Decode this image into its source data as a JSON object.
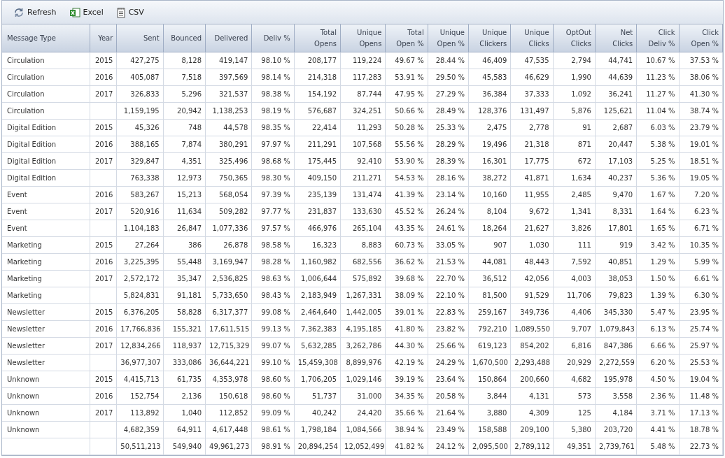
{
  "toolbar": [
    {
      "kind": "refresh",
      "label": "Refresh"
    },
    {
      "kind": "excel",
      "label": "Excel"
    },
    {
      "kind": "csv",
      "label": "CSV"
    }
  ],
  "table": {
    "columns": [
      "Message Type",
      "Year",
      "Sent",
      "Bounced",
      "Delivered",
      "Deliv %",
      "Total Opens",
      "Unique Opens",
      "Total Open %",
      "Unique Open %",
      "Unique Clickers",
      "Unique Clicks",
      "OptOut Clicks",
      "Net Clicks",
      "Click Deliv %",
      "Click Open %"
    ],
    "rows": [
      [
        "Circulation",
        "2015",
        "427,275",
        "8,128",
        "419,147",
        "98.10 %",
        "208,177",
        "119,224",
        "49.67 %",
        "28.44 %",
        "46,409",
        "47,535",
        "2,794",
        "44,741",
        "10.67 %",
        "37.53 %"
      ],
      [
        "Circulation",
        "2016",
        "405,087",
        "7,518",
        "397,569",
        "98.14 %",
        "214,318",
        "117,283",
        "53.91 %",
        "29.50 %",
        "45,583",
        "46,629",
        "1,990",
        "44,639",
        "11.23 %",
        "38.06 %"
      ],
      [
        "Circulation",
        "2017",
        "326,833",
        "5,296",
        "321,537",
        "98.38 %",
        "154,192",
        "87,744",
        "47.95 %",
        "27.29 %",
        "36,384",
        "37,333",
        "1,092",
        "36,241",
        "11.27 %",
        "41.30 %"
      ],
      [
        "Circulation",
        "",
        "1,159,195",
        "20,942",
        "1,138,253",
        "98.19 %",
        "576,687",
        "324,251",
        "50.66 %",
        "28.49 %",
        "128,376",
        "131,497",
        "5,876",
        "125,621",
        "11.04 %",
        "38.74 %"
      ],
      [
        "Digital Edition",
        "2015",
        "45,326",
        "748",
        "44,578",
        "98.35 %",
        "22,414",
        "11,293",
        "50.28 %",
        "25.33 %",
        "2,475",
        "2,778",
        "91",
        "2,687",
        "6.03 %",
        "23.79 %"
      ],
      [
        "Digital Edition",
        "2016",
        "388,165",
        "7,874",
        "380,291",
        "97.97 %",
        "211,291",
        "107,568",
        "55.56 %",
        "28.29 %",
        "19,496",
        "21,318",
        "871",
        "20,447",
        "5.38 %",
        "19.01 %"
      ],
      [
        "Digital Edition",
        "2017",
        "329,847",
        "4,351",
        "325,496",
        "98.68 %",
        "175,445",
        "92,410",
        "53.90 %",
        "28.39 %",
        "16,301",
        "17,775",
        "672",
        "17,103",
        "5.25 %",
        "18.51 %"
      ],
      [
        "Digital Edition",
        "",
        "763,338",
        "12,973",
        "750,365",
        "98.30 %",
        "409,150",
        "211,271",
        "54.53 %",
        "28.16 %",
        "38,272",
        "41,871",
        "1,634",
        "40,237",
        "5.36 %",
        "19.05 %"
      ],
      [
        "Event",
        "2016",
        "583,267",
        "15,213",
        "568,054",
        "97.39 %",
        "235,139",
        "131,474",
        "41.39 %",
        "23.14 %",
        "10,160",
        "11,955",
        "2,485",
        "9,470",
        "1.67 %",
        "7.20 %"
      ],
      [
        "Event",
        "2017",
        "520,916",
        "11,634",
        "509,282",
        "97.77 %",
        "231,837",
        "133,630",
        "45.52 %",
        "26.24 %",
        "8,104",
        "9,672",
        "1,341",
        "8,331",
        "1.64 %",
        "6.23 %"
      ],
      [
        "Event",
        "",
        "1,104,183",
        "26,847",
        "1,077,336",
        "97.57 %",
        "466,976",
        "265,104",
        "43.35 %",
        "24.61 %",
        "18,264",
        "21,627",
        "3,826",
        "17,801",
        "1.65 %",
        "6.71 %"
      ],
      [
        "Marketing",
        "2015",
        "27,264",
        "386",
        "26,878",
        "98.58 %",
        "16,323",
        "8,883",
        "60.73 %",
        "33.05 %",
        "907",
        "1,030",
        "111",
        "919",
        "3.42 %",
        "10.35 %"
      ],
      [
        "Marketing",
        "2016",
        "3,225,395",
        "55,448",
        "3,169,947",
        "98.28 %",
        "1,160,982",
        "682,556",
        "36.62 %",
        "21.53 %",
        "44,081",
        "48,443",
        "7,592",
        "40,851",
        "1.29 %",
        "5.99 %"
      ],
      [
        "Marketing",
        "2017",
        "2,572,172",
        "35,347",
        "2,536,825",
        "98.63 %",
        "1,006,644",
        "575,892",
        "39.68 %",
        "22.70 %",
        "36,512",
        "42,056",
        "4,003",
        "38,053",
        "1.50 %",
        "6.61 %"
      ],
      [
        "Marketing",
        "",
        "5,824,831",
        "91,181",
        "5,733,650",
        "98.43 %",
        "2,183,949",
        "1,267,331",
        "38.09 %",
        "22.10 %",
        "81,500",
        "91,529",
        "11,706",
        "79,823",
        "1.39 %",
        "6.30 %"
      ],
      [
        "Newsletter",
        "2015",
        "6,376,205",
        "58,828",
        "6,317,377",
        "99.08 %",
        "2,464,640",
        "1,442,005",
        "39.01 %",
        "22.83 %",
        "259,167",
        "349,736",
        "4,406",
        "345,330",
        "5.47 %",
        "23.95 %"
      ],
      [
        "Newsletter",
        "2016",
        "17,766,836",
        "155,321",
        "17,611,515",
        "99.13 %",
        "7,362,383",
        "4,195,185",
        "41.80 %",
        "23.82 %",
        "792,210",
        "1,089,550",
        "9,707",
        "1,079,843",
        "6.13 %",
        "25.74 %"
      ],
      [
        "Newsletter",
        "2017",
        "12,834,266",
        "118,937",
        "12,715,329",
        "99.07 %",
        "5,632,285",
        "3,262,786",
        "44.30 %",
        "25.66 %",
        "619,123",
        "854,202",
        "6,816",
        "847,386",
        "6.66 %",
        "25.97 %"
      ],
      [
        "Newsletter",
        "",
        "36,977,307",
        "333,086",
        "36,644,221",
        "99.10 %",
        "15,459,308",
        "8,899,976",
        "42.19 %",
        "24.29 %",
        "1,670,500",
        "2,293,488",
        "20,929",
        "2,272,559",
        "6.20 %",
        "25.53 %"
      ],
      [
        "Unknown",
        "2015",
        "4,415,713",
        "61,735",
        "4,353,978",
        "98.60 %",
        "1,706,205",
        "1,029,146",
        "39.19 %",
        "23.64 %",
        "150,864",
        "200,660",
        "4,682",
        "195,978",
        "4.50 %",
        "19.04 %"
      ],
      [
        "Unknown",
        "2016",
        "152,754",
        "2,136",
        "150,618",
        "98.60 %",
        "51,737",
        "31,000",
        "34.35 %",
        "20.58 %",
        "3,844",
        "4,131",
        "573",
        "3,558",
        "2.36 %",
        "11.48 %"
      ],
      [
        "Unknown",
        "2017",
        "113,892",
        "1,040",
        "112,852",
        "99.09 %",
        "40,242",
        "24,420",
        "35.66 %",
        "21.64 %",
        "3,880",
        "4,309",
        "125",
        "4,184",
        "3.71 %",
        "17.13 %"
      ],
      [
        "Unknown",
        "",
        "4,682,359",
        "64,911",
        "4,617,448",
        "98.61 %",
        "1,798,184",
        "1,084,566",
        "38.94 %",
        "23.49 %",
        "158,588",
        "209,100",
        "5,380",
        "203,720",
        "4.41 %",
        "18.78 %"
      ],
      [
        "",
        "",
        "50,511,213",
        "549,940",
        "49,961,273",
        "98.91 %",
        "20,894,254",
        "12,052,499",
        "41.82 %",
        "24.12 %",
        "2,095,500",
        "2,789,112",
        "49,351",
        "2,739,761",
        "5.48 %",
        "22.73 %"
      ]
    ]
  }
}
